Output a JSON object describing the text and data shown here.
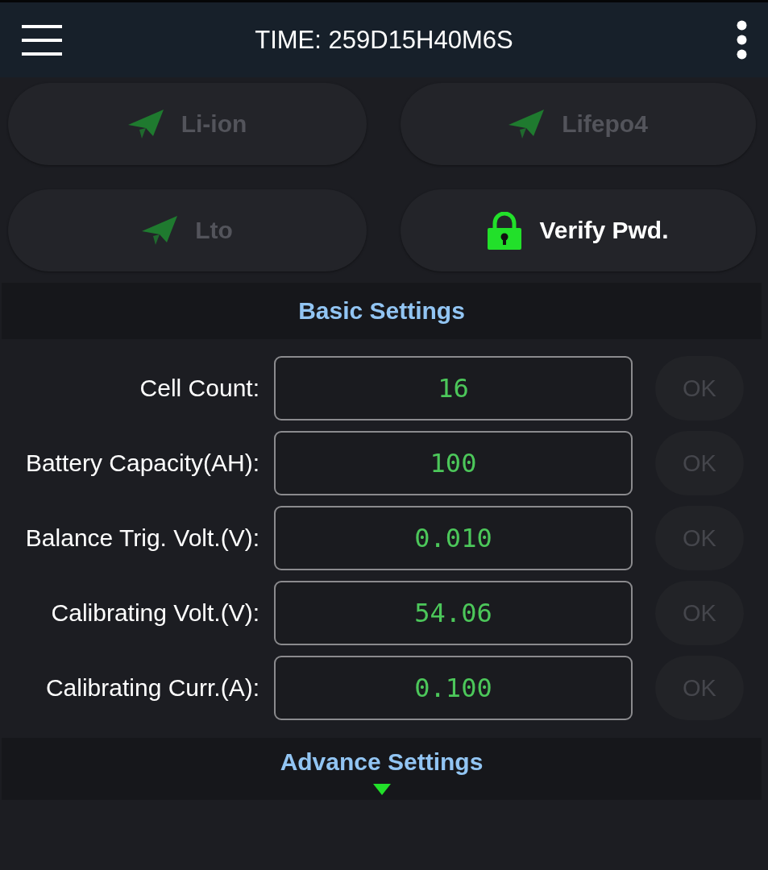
{
  "app_bar": {
    "title": "TIME: 259D15H40M6S"
  },
  "mode_buttons": [
    {
      "kind": "battery-type",
      "label": "Li-ion",
      "disabled": true
    },
    {
      "kind": "battery-type",
      "label": "Lifepo4",
      "disabled": true
    },
    {
      "kind": "battery-type",
      "label": "Lto",
      "disabled": true
    },
    {
      "kind": "password",
      "label": "Verify Pwd.",
      "disabled": false
    }
  ],
  "basic_settings": {
    "title": "Basic Settings",
    "fields": [
      {
        "label": "Cell Count:",
        "value": "16",
        "button": {
          "label": "OK",
          "disabled": true
        }
      },
      {
        "label": "Battery Capacity(AH):",
        "value": "100",
        "button": {
          "label": "OK",
          "disabled": true
        }
      },
      {
        "label": "Balance Trig. Volt.(V):",
        "value": "0.010",
        "button": {
          "label": "OK",
          "disabled": true
        }
      },
      {
        "label": "Calibrating Volt.(V):",
        "value": "54.06",
        "button": {
          "label": "OK",
          "disabled": true
        }
      },
      {
        "label": "Calibrating Curr.(A):",
        "value": "0.100",
        "button": {
          "label": "OK",
          "disabled": true
        }
      }
    ]
  },
  "advance_settings": {
    "title": "Advance Settings",
    "expanded": false
  }
}
